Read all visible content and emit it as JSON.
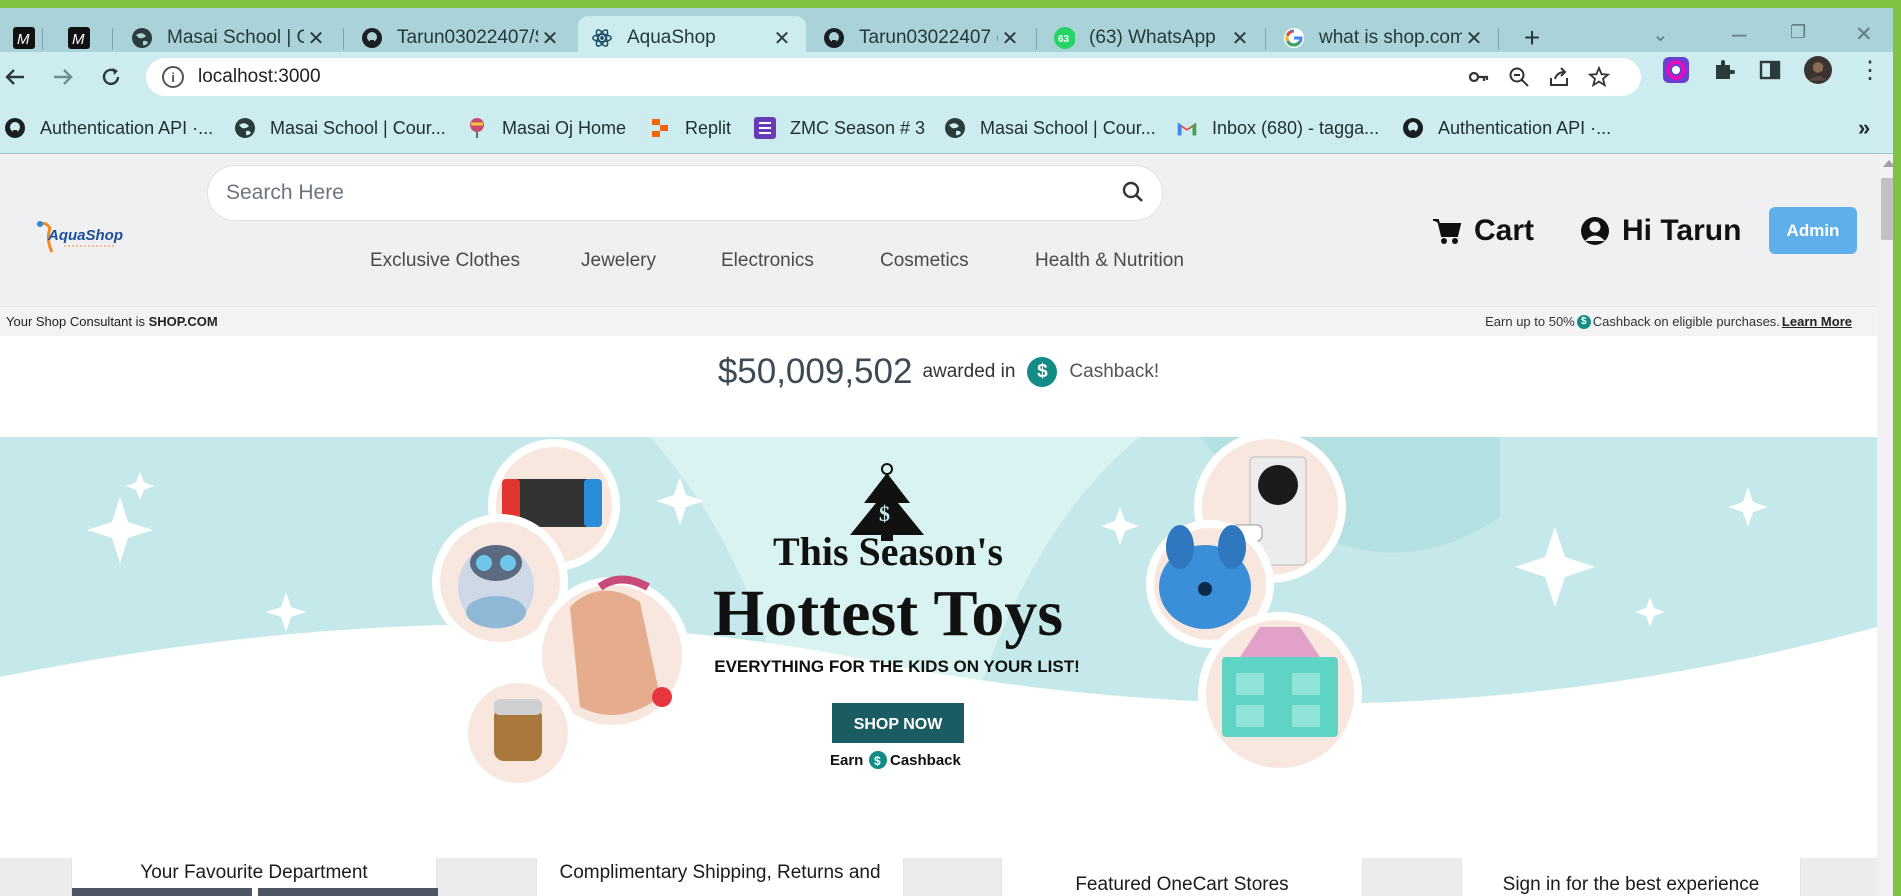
{
  "browser": {
    "tabs": [
      {
        "title": "",
        "icon": "masai-m-icon"
      },
      {
        "title": "",
        "icon": "masai-m-icon"
      },
      {
        "title": "Masai School | C",
        "icon": "globe-icon"
      },
      {
        "title": "Tarun03022407/S",
        "icon": "github-icon"
      },
      {
        "title": "AquaShop",
        "icon": "react-icon",
        "active": true
      },
      {
        "title": "Tarun03022407 (",
        "icon": "github-icon"
      },
      {
        "title": "(63) WhatsApp",
        "icon": "whatsapp-icon",
        "badge": "63"
      },
      {
        "title": "what is shop.com",
        "icon": "google-icon"
      }
    ],
    "new_tab": "+",
    "url": "localhost:3000",
    "bookmarks": [
      {
        "label": "Authentication API ·...",
        "icon": "github-icon"
      },
      {
        "label": "Masai School | Cour...",
        "icon": "globe-icon"
      },
      {
        "label": "Masai Oj Home",
        "icon": "balloon-icon"
      },
      {
        "label": "Replit",
        "icon": "replit-icon"
      },
      {
        "label": "ZMC Season # 3",
        "icon": "list-icon"
      },
      {
        "label": "Masai School | Cour...",
        "icon": "globe-icon"
      },
      {
        "label": "Inbox (680) - tagga...",
        "icon": "gmail-icon"
      },
      {
        "label": "Authentication API ·...",
        "icon": "github-icon"
      }
    ],
    "more": "»",
    "theme_colors": {
      "chrome": "#a9d3d8",
      "active_tab": "#cdecef",
      "accent": "#7ec242"
    }
  },
  "header": {
    "logo_text": "AquaShop",
    "search_placeholder": "Search Here",
    "categories": [
      "Exclusive Clothes",
      "Jewelery",
      "Electronics",
      "Cosmetics",
      "Health & Nutrition"
    ],
    "cart_label": "Cart",
    "greeting": "Hi Tarun",
    "admin_label": "Admin",
    "admin_color": "#5fb0ea"
  },
  "promo": {
    "consultant_prefix": "Your Shop Consultant is ",
    "consultant_brand": "SHOP.COM",
    "earn_prefix": "Earn up to 50%",
    "earn_suffix": "Cashback on eligible purchases.",
    "learn_more": "Learn More"
  },
  "awarded": {
    "amount": "$50,009,502",
    "text": "awarded in",
    "coin": "$",
    "cashback": "Cashback!"
  },
  "banner": {
    "line1": "This Season's",
    "line2": "Hottest Toys",
    "subtitle": "EVERYTHING FOR THE KIDS ON YOUR LIST!",
    "cta": "SHOP NOW",
    "earn": "Earn",
    "earn_coin": "$",
    "earn_cashback": "Cashback",
    "bg_color": "#c7ebec",
    "cta_color": "#1a5c61"
  },
  "bottom": {
    "favourite_department": "Your Favourite Department",
    "shipping_line": "Complimentary Shipping, Returns and",
    "featured": "Featured OneCart Stores",
    "sign_in": "Sign in for the best experience"
  }
}
